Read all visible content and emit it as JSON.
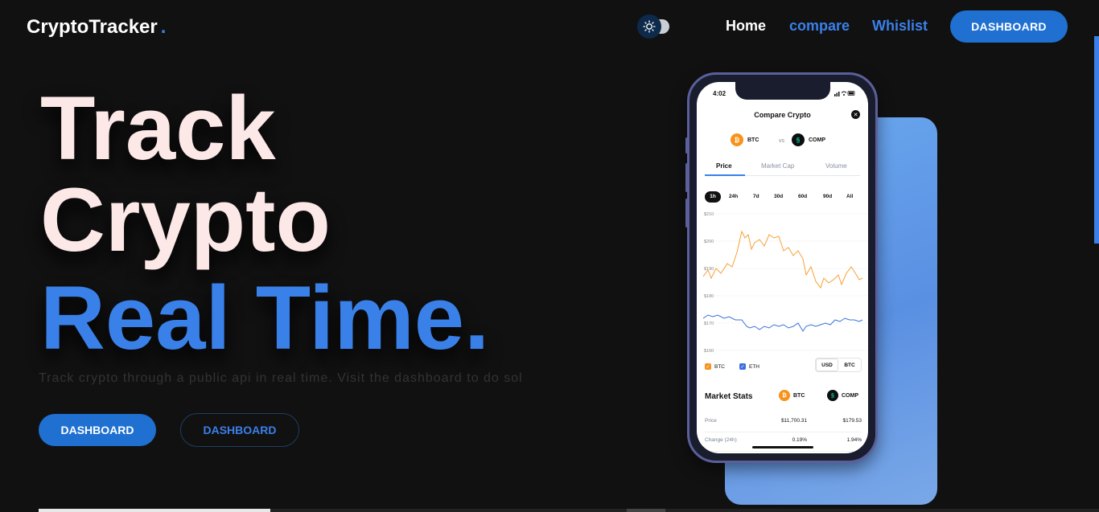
{
  "header": {
    "logo": "CryptoTracker",
    "logo_dot": ".",
    "theme_toggle_icon": "sun-icon",
    "nav": {
      "home": "Home",
      "compare": "compare",
      "whislist": "Whislist",
      "dashboard": "DASHBOARD"
    }
  },
  "hero": {
    "line1": "Track",
    "line2": "Crypto",
    "line3": "Real Time.",
    "subtitle": "Track crypto through a public api in real time. Visit the dashboard to do sol",
    "primary_button": "DASHBOARD",
    "secondary_button": "DASHBOARD"
  },
  "phone": {
    "time": "4:02",
    "title": "Compare Crypto",
    "coin_a": "BTC",
    "vs": "vs",
    "coin_b": "COMP",
    "tabs": [
      "Price",
      "Market Cap",
      "Volume"
    ],
    "ranges": [
      "1h",
      "24h",
      "7d",
      "30d",
      "60d",
      "90d",
      "All"
    ],
    "chart_y_labels": [
      "$210",
      "$200",
      "$190",
      "$180",
      "$170",
      "$160"
    ],
    "legend": [
      "BTC",
      "ETH"
    ],
    "currency_toggle": [
      "USD",
      "BTC"
    ],
    "market_stats": {
      "title": "Market Stats",
      "coin_a": "BTC",
      "coin_b": "COMP",
      "rows": [
        {
          "label": "Price",
          "a": "$11,700.31",
          "b": "$179.53"
        },
        {
          "label": "Change (24h)",
          "a": "0.19%",
          "b": "1.94%"
        }
      ]
    }
  },
  "colors": {
    "accent": "#3a80e9",
    "button": "#1f70d1",
    "background": "#111111",
    "btc_line": "#f7a035",
    "eth_line": "#3a6fe0"
  }
}
